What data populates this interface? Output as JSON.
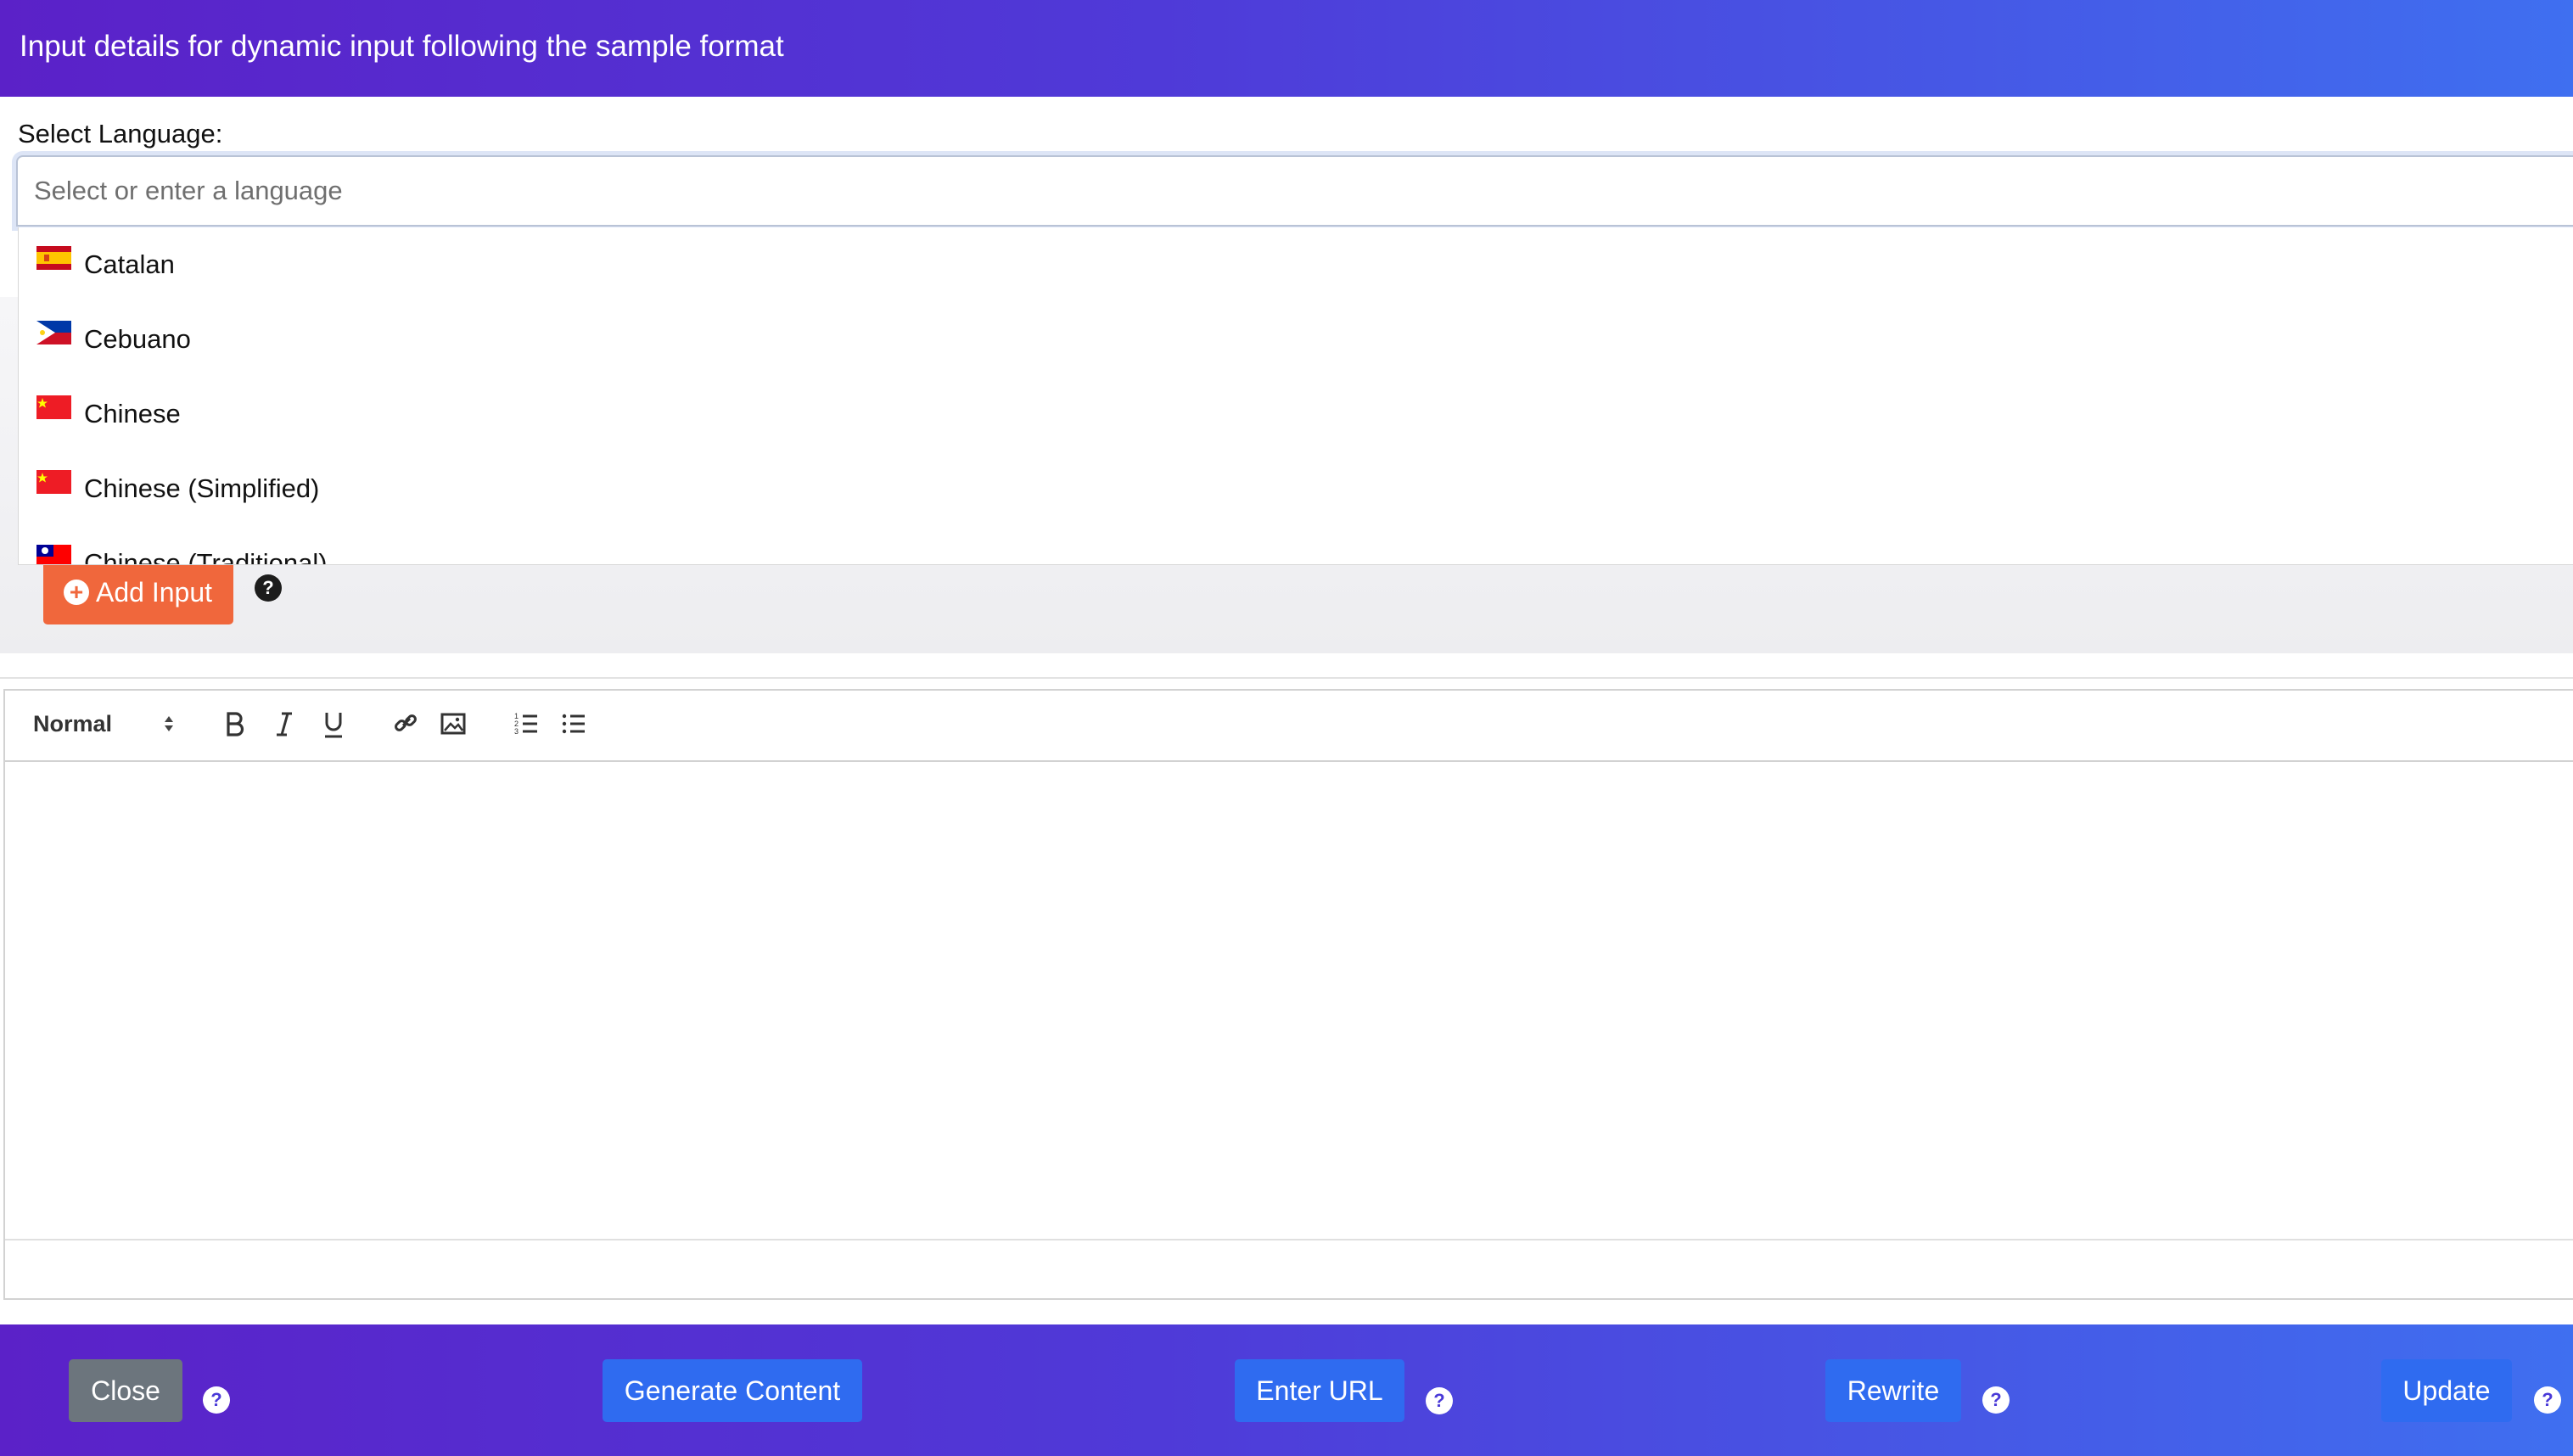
{
  "header": {
    "title": "Input details for dynamic input following the sample format"
  },
  "language": {
    "label": "Select Language:",
    "placeholder": "Select or enter a language",
    "options": [
      {
        "label": "Catalan",
        "flag": "es-catalan-flag"
      },
      {
        "label": "Cebuano",
        "flag": "ph-flag"
      },
      {
        "label": "Chinese",
        "flag": "cn-flag"
      },
      {
        "label": "Chinese (Simplified)",
        "flag": "cn-flag"
      },
      {
        "label": "Chinese (Traditional)",
        "flag": "tw-flag"
      }
    ]
  },
  "inputs": {
    "add_label": "Add Input",
    "help": "?"
  },
  "editor": {
    "format_value": "Normal"
  },
  "footer": {
    "close_label": "Close",
    "generate_label": "Generate Content",
    "enter_url_label": "Enter URL",
    "rewrite_label": "Rewrite",
    "update_label": "Update",
    "help": "?"
  },
  "colors": {
    "header_gradient_start": "#5b21c8",
    "header_gradient_end": "#3f6ff0",
    "add_button": "#f0673c",
    "primary_button": "#2f6bf0",
    "close_button": "#6c757d"
  }
}
